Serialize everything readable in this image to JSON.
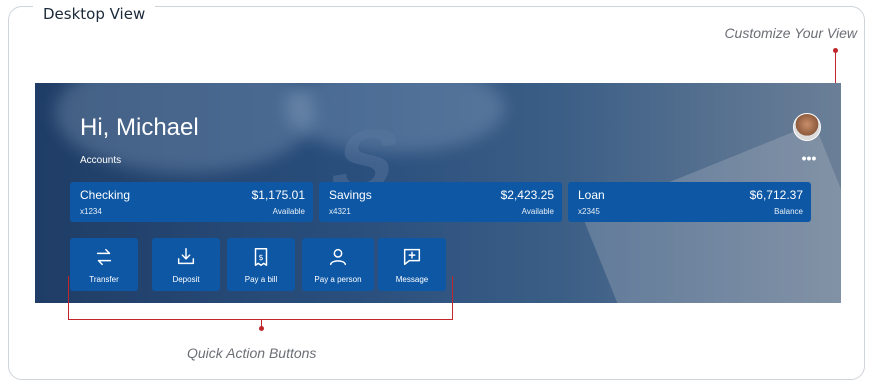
{
  "frame_title": "Desktop View",
  "annotations": {
    "customize": "Customize Your View",
    "quick_actions": "Quick Action Buttons"
  },
  "dashboard": {
    "greeting": "Hi, Michael",
    "accounts_label": "Accounts",
    "more_label": "•••",
    "accounts": [
      {
        "name": "Checking",
        "number": "x1234",
        "amount": "$1,175.01",
        "sub": "Available"
      },
      {
        "name": "Savings",
        "number": "x4321",
        "amount": "$2,423.25",
        "sub": "Available"
      },
      {
        "name": "Loan",
        "number": "x2345",
        "amount": "$6,712.37",
        "sub": "Balance"
      }
    ],
    "quick_actions": [
      {
        "label": "Transfer",
        "icon": "transfer-icon"
      },
      {
        "label": "Deposit",
        "icon": "deposit-icon"
      },
      {
        "label": "Pay a bill",
        "icon": "bill-icon"
      },
      {
        "label": "Pay a person",
        "icon": "person-icon"
      },
      {
        "label": "Message",
        "icon": "message-icon"
      }
    ]
  },
  "colors": {
    "card_blue": "#0d57a5",
    "annotation_red": "#c1262c",
    "annotation_text": "#6b6f75"
  }
}
